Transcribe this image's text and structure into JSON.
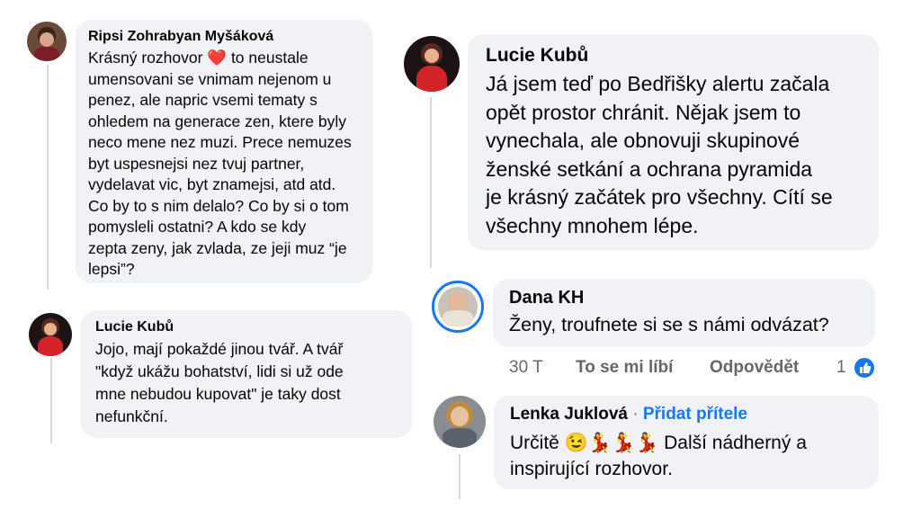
{
  "comments": [
    {
      "author": "Ripsi Zohrabyan Myšáková",
      "text_before_heart": "Krásný rozhovor ",
      "heart": "❤️",
      "text_after_heart": " to neustale\numensovani se vnimam nejenom u\npenez, ale napric vsemi tematy s\nohledem na generace zen, ktere byly\nneco mene nez muzi. Prece nemuzes\nbyt uspesnejsi nez tvuj partner,\nvydelavat vic, byt znamejsi, atd atd.\nCo by to s nim delalo? Co by si o tom\npomysleli ostatni? A kdo se kdy\nzepta zeny, jak zvlada, ze jeji muz “je\nlepsi”?"
    },
    {
      "author": "Lucie Kubů",
      "text": "Jojo, mají pokaždé jinou tvář. A tvář\n\"když ukážu bohatství, lidi si už ode\nmne nebudou kupovat\" je taky dost\nnefunkční."
    },
    {
      "author": "Lucie Kubů",
      "text": "Já jsem teď po Bedřišky alertu začala\nopět prostor chránit. Nějak jsem to\nvynechala, ale obnovuji skupinové\nženské setkání a ochrana pyramida\nje krásný začátek pro všechny. Cítí se\nvšechny mnohem lépe."
    },
    {
      "author": "Dana KH",
      "text": "Ženy, troufnete si se s námi odvázat?",
      "time": "30 T",
      "like_label": "To se mi líbí",
      "reply_label": "Odpovědět",
      "reaction_count": "1"
    },
    {
      "author": "Lenka Juklová",
      "separator": "·",
      "add_friend": "Přidat přítele",
      "text_start": "Určitě ",
      "emojis": "😉💃💃💃",
      "text_end": " Další nádherný a\ninspirující rozhovor."
    }
  ],
  "colors": {
    "bubble": "#f0f2f5",
    "link": "#1877f2",
    "meta": "#65676b"
  }
}
